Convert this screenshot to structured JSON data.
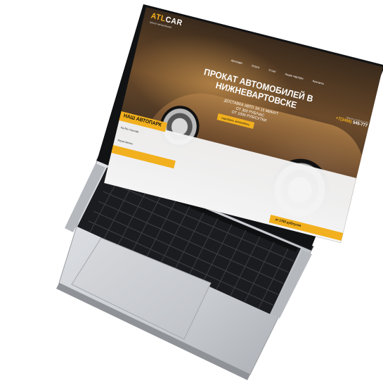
{
  "site": {
    "logo_main": "ATL",
    "logo_accent": "CAR",
    "logo_sub": "прокат автомобилей"
  },
  "nav": {
    "items": [
      {
        "label": "Автопарк"
      },
      {
        "label": "Услуги"
      },
      {
        "label": "О нас"
      },
      {
        "label": "Акции чартеры"
      },
      {
        "label": "Контакты"
      }
    ]
  },
  "contact": {
    "caption": "Звоните с 9:00 до 21:00",
    "phone_code": "+7(3466)",
    "phone_number": "545-777"
  },
  "hero": {
    "headline": "ПРОКАТ АВТОМОБИЛЕЙ В НИЖНЕВАРТОВСКЕ",
    "subline_1": "ДОСТАВКА АВТО ЗА 15 МИНУТ",
    "subline_2": "ОТ 350 РУБ/ЧАС",
    "subline_3": "ОТ 1000 РУБ/СУТКИ",
    "cta_label": "подобрать автомобиль"
  },
  "fleet": {
    "title": "НАШ АВТОПАРК",
    "card_1_label": "Kia Rio / Hyundai",
    "card_2_label": "Nissan Almera",
    "price_label": "от 1750 руб/сутки"
  },
  "colors": {
    "accent": "#f2b01e",
    "laptop_silver": "#c9ccd1",
    "keyboard": "#1b1c1f"
  }
}
